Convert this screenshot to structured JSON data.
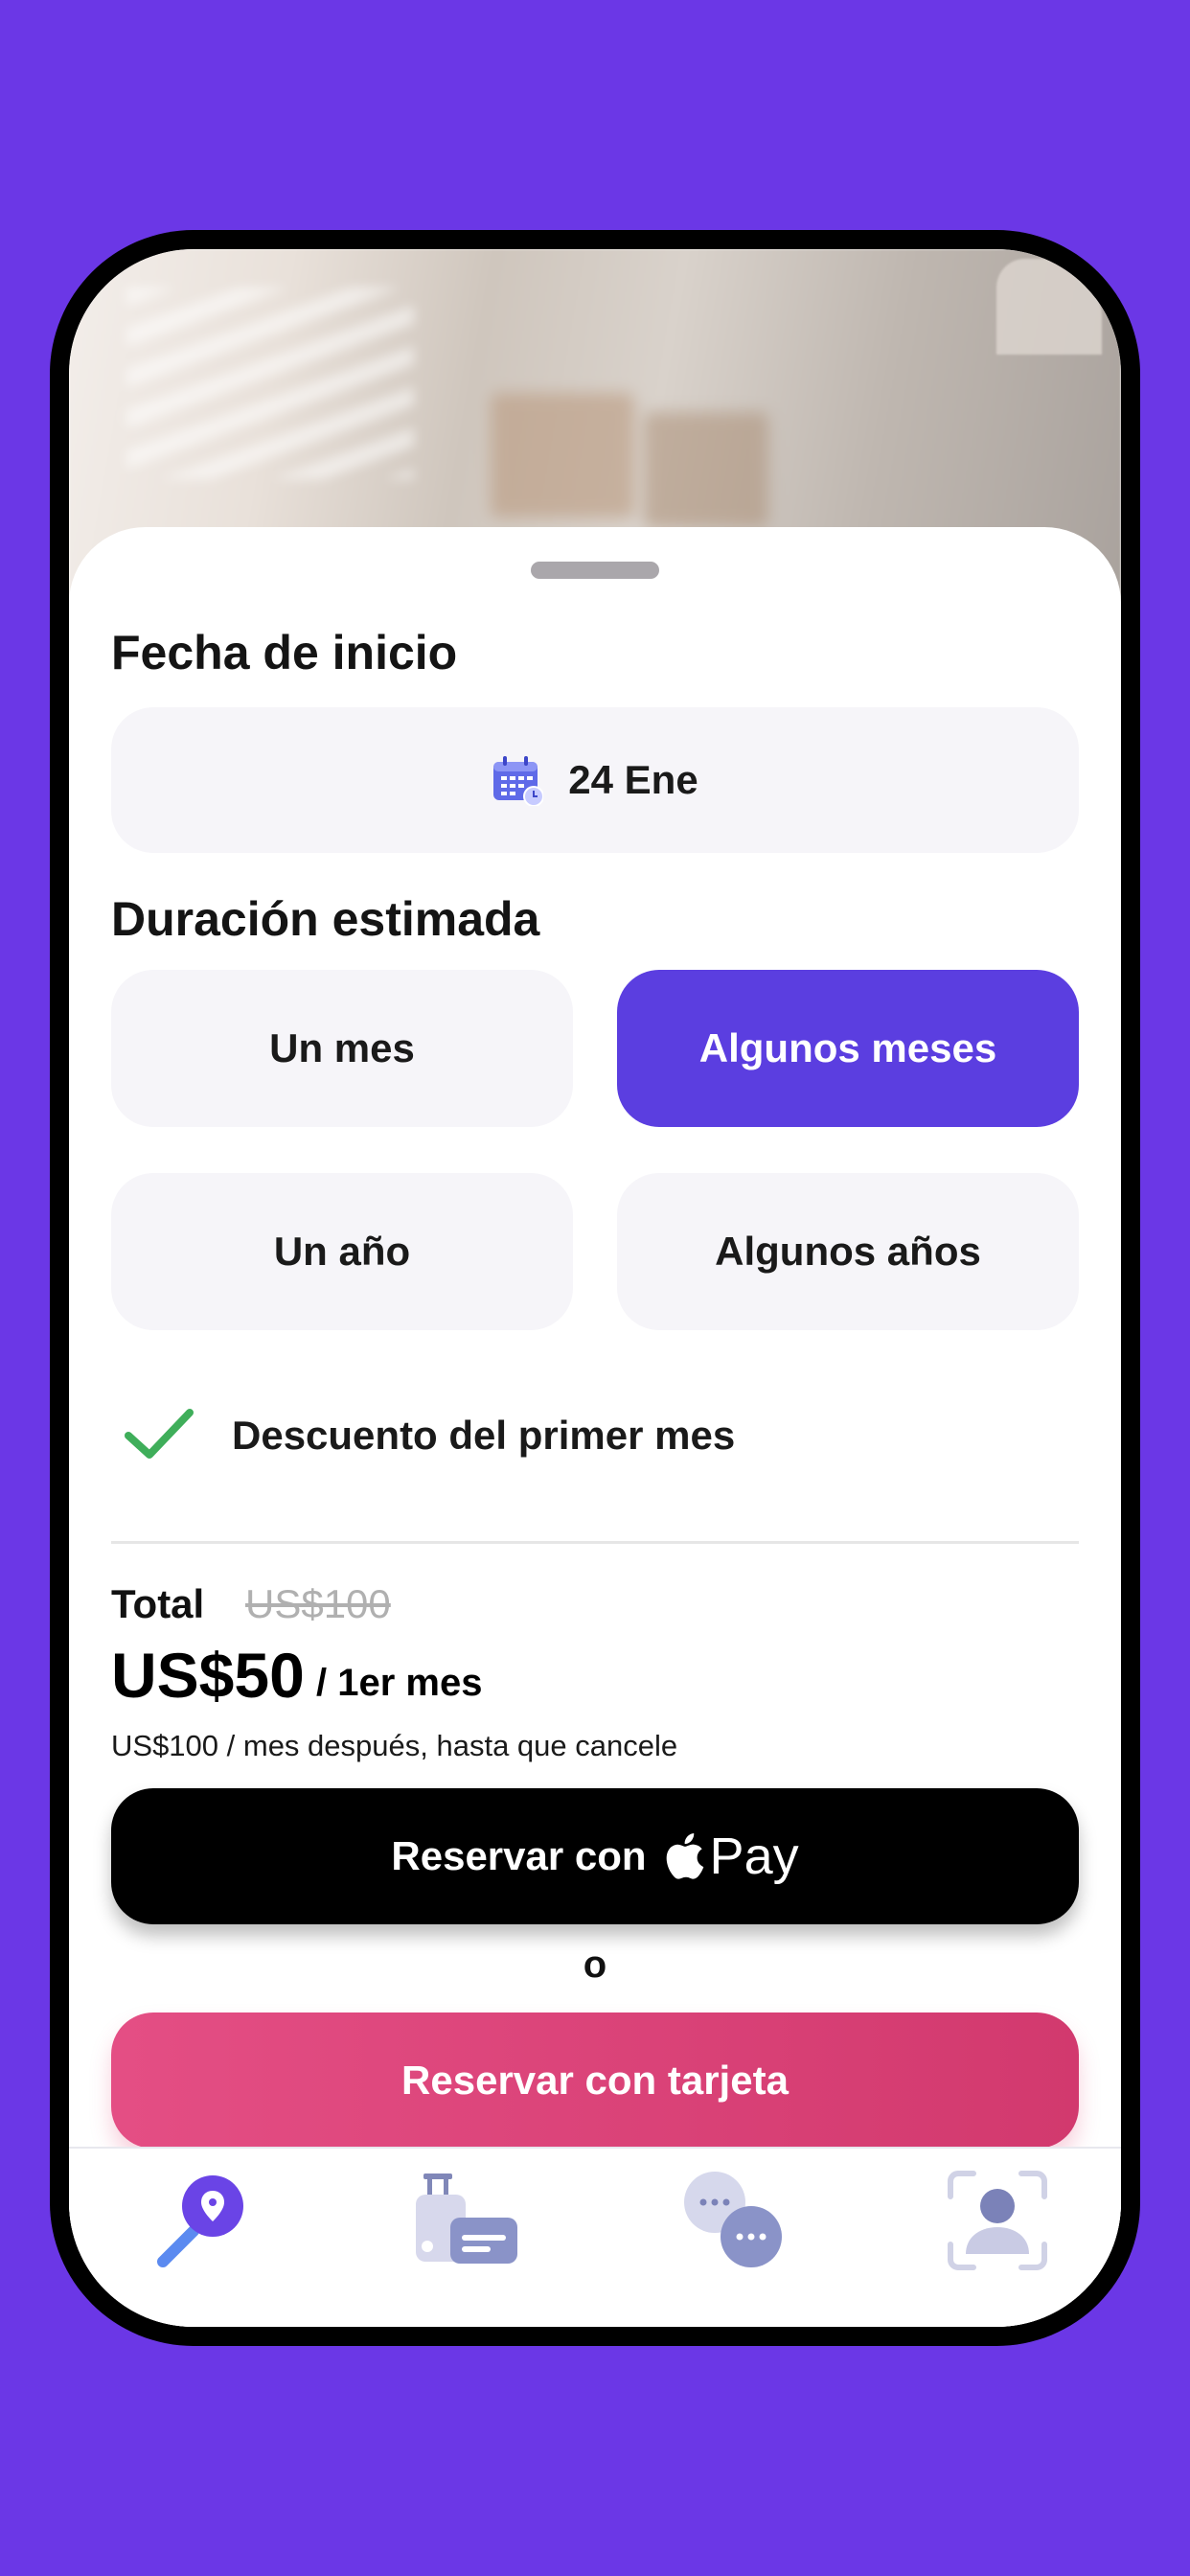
{
  "colors": {
    "background": "#6b37e6",
    "accent": "#5b3ee0",
    "card_button": "#e0457f",
    "check": "#3fae5a"
  },
  "start_date": {
    "label": "Fecha de inicio",
    "value": "24 Ene",
    "icon": "calendar-icon"
  },
  "duration": {
    "label": "Duración estimada",
    "options": [
      {
        "label": "Un mes",
        "selected": false
      },
      {
        "label": "Algunos meses",
        "selected": true
      },
      {
        "label": "Un año",
        "selected": false
      },
      {
        "label": "Algunos años",
        "selected": false
      }
    ]
  },
  "discount": {
    "label": "Descuento del primer mes",
    "checked": true
  },
  "price": {
    "total_label": "Total",
    "original": "US$100",
    "amount": "US$50",
    "period": "/ 1er mes",
    "after_text": "US$100 / mes después, hasta que cancele"
  },
  "apple_pay_button": {
    "label": "Reservar con",
    "pay": "Pay"
  },
  "or_text": "o",
  "card_button": {
    "label": "Reservar con tarjeta"
  },
  "tabbar": {
    "items": [
      {
        "icon": "search-location-icon",
        "active": true
      },
      {
        "icon": "luggage-icon",
        "active": false
      },
      {
        "icon": "chat-icon",
        "active": false
      },
      {
        "icon": "profile-icon",
        "active": false
      }
    ]
  }
}
